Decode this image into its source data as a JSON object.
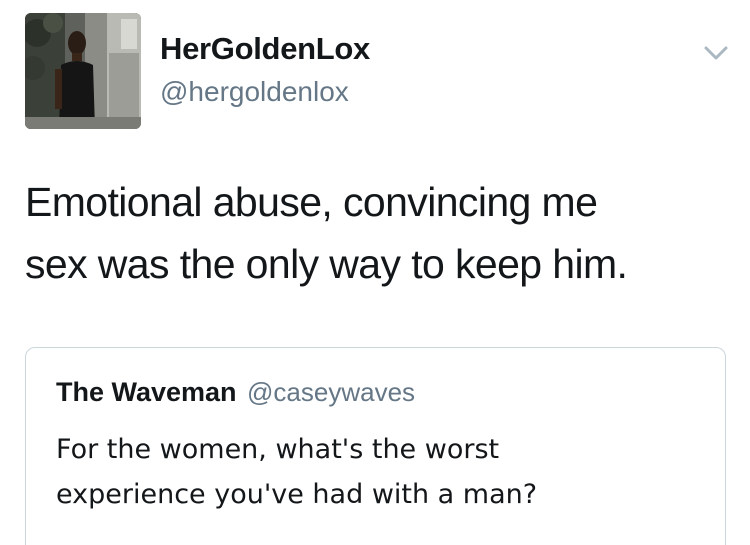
{
  "tweet": {
    "author": {
      "display_name": "HerGoldenLox",
      "handle": "@hergoldenlox",
      "avatar_icon": "profile-photo"
    },
    "menu_icon": "chevron-down-icon",
    "text": "Emotional abuse, convincing me\nsex was the only way to keep him."
  },
  "quoted_tweet": {
    "display_name": "The Waveman",
    "handle": "@caseywaves",
    "text": "For the women, what's the worst\nexperience you've had with a man?"
  },
  "colors": {
    "text": "#14171a",
    "secondary_text": "#657786",
    "border": "#ccd6dd",
    "chevron": "#aab8c2"
  }
}
